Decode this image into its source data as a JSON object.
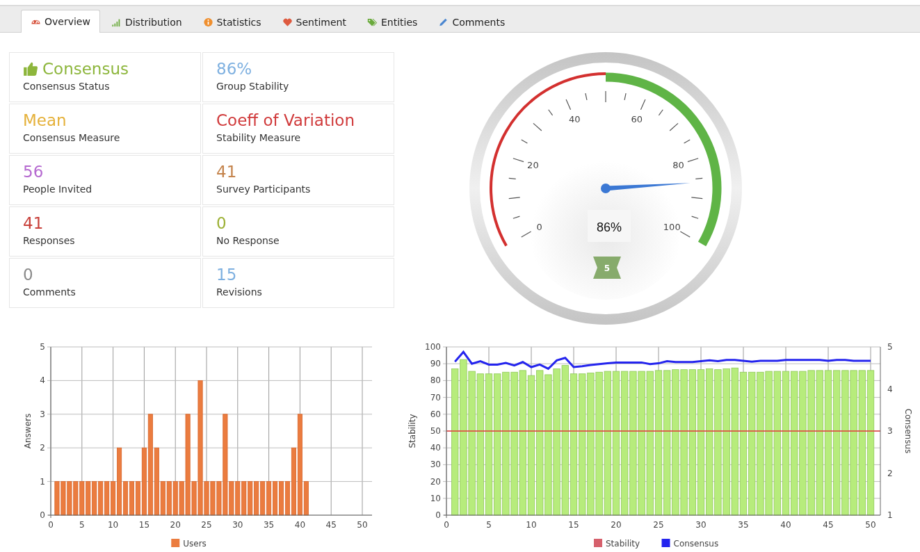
{
  "tabs": [
    {
      "label": "Overview",
      "selected": true
    },
    {
      "label": "Distribution",
      "selected": false
    },
    {
      "label": "Statistics",
      "selected": false
    },
    {
      "label": "Sentiment",
      "selected": false
    },
    {
      "label": "Entities",
      "selected": false
    },
    {
      "label": "Comments",
      "selected": false
    }
  ],
  "stats": [
    {
      "value": "Consensus",
      "label": "Consensus Status",
      "color": "#8db63c",
      "kind": "icon"
    },
    {
      "value": "86%",
      "label": "Group Stability",
      "color": "#7eb0e0",
      "kind": "plain"
    },
    {
      "value": "Mean",
      "label": "Consensus Measure",
      "color": "#e5b13a",
      "kind": "plain"
    },
    {
      "value": "Coeff of Variation",
      "label": "Stability Measure",
      "color": "#d03a3b",
      "kind": "plain"
    },
    {
      "value": "56",
      "label": "People Invited",
      "color": "#b569d0",
      "kind": "plain"
    },
    {
      "value": "41",
      "label": "Survey Participants",
      "color": "#c4834b",
      "kind": "plain"
    },
    {
      "value": "41",
      "label": "Responses",
      "color": "#c8403a",
      "kind": "plain"
    },
    {
      "value": "0",
      "label": "No Response",
      "color": "#9cb034",
      "kind": "plain"
    },
    {
      "value": "0",
      "label": "Comments",
      "color": "#8a8a8a",
      "kind": "plain"
    },
    {
      "value": "15",
      "label": "Revisions",
      "color": "#7eb0e0",
      "kind": "plain"
    }
  ],
  "gauge": {
    "reading": "86%",
    "badge": "5",
    "scale_labels": [
      "0",
      "20",
      "40",
      "60",
      "80",
      "100"
    ],
    "bands": [
      {
        "color": "#d3302f"
      },
      {
        "color": "#5fb446"
      }
    ]
  },
  "distribution_chart": {
    "chart_data": {
      "type": "bar",
      "ylabel": "Answers",
      "x": [
        1,
        2,
        3,
        4,
        5,
        6,
        7,
        8,
        9,
        10,
        11,
        12,
        13,
        14,
        15,
        16,
        17,
        18,
        19,
        20,
        21,
        22,
        23,
        24,
        25,
        26,
        27,
        28,
        29,
        30,
        31,
        32,
        33,
        34,
        35,
        36,
        37,
        38,
        39,
        40,
        41
      ],
      "series": [
        {
          "name": "Users",
          "color": "#eb7c3f",
          "values": [
            1,
            1,
            1,
            1,
            1,
            1,
            1,
            1,
            1,
            1,
            2,
            1,
            1,
            1,
            2,
            3,
            2,
            1,
            1,
            1,
            1,
            3,
            1,
            4,
            1,
            1,
            1,
            3,
            1,
            1,
            1,
            1,
            1,
            1,
            1,
            1,
            1,
            1,
            2,
            3,
            1
          ]
        }
      ],
      "xlim": [
        0,
        50
      ],
      "ylim": [
        0,
        5
      ],
      "xticks": [
        0,
        5,
        10,
        15,
        20,
        25,
        30,
        35,
        40,
        45,
        50
      ],
      "yticks": [
        0,
        1,
        2,
        3,
        4,
        5
      ],
      "grid": true
    }
  },
  "stability_chart": {
    "chart_data": {
      "type": "bar",
      "ylabel": "Stability",
      "y2label": "Consensus",
      "x": [
        1,
        2,
        3,
        4,
        5,
        6,
        7,
        8,
        9,
        10,
        11,
        12,
        13,
        14,
        15,
        16,
        17,
        18,
        19,
        20,
        21,
        22,
        23,
        24,
        25,
        26,
        27,
        28,
        29,
        30,
        31,
        32,
        33,
        34,
        35,
        36,
        37,
        38,
        39,
        40,
        41,
        42,
        43,
        44,
        45,
        46,
        47,
        48,
        49,
        50
      ],
      "series": [
        {
          "name": "Stability",
          "color": "#b7ec7c",
          "values": [
            87,
            92.5,
            85.5,
            84,
            84,
            84,
            85,
            85,
            86,
            83,
            86,
            83.5,
            87,
            89,
            84,
            84,
            84.5,
            85,
            85.5,
            85.5,
            85.5,
            85.5,
            85.5,
            85.5,
            86,
            86,
            86.5,
            86.5,
            86.5,
            86.5,
            87,
            86.5,
            87,
            87.5,
            85,
            85,
            85,
            85.5,
            85.5,
            85.5,
            85.5,
            85.5,
            86,
            86,
            86,
            86,
            86,
            86,
            86,
            86
          ]
        },
        {
          "name": "Consensus",
          "type": "line",
          "axis": "y2",
          "color": "#2424ee",
          "values": [
            4.65,
            4.88,
            4.6,
            4.66,
            4.58,
            4.58,
            4.62,
            4.56,
            4.64,
            4.52,
            4.58,
            4.48,
            4.68,
            4.74,
            4.52,
            4.54,
            4.57,
            4.59,
            4.61,
            4.63,
            4.63,
            4.63,
            4.63,
            4.59,
            4.61,
            4.66,
            4.64,
            4.64,
            4.64,
            4.66,
            4.68,
            4.66,
            4.69,
            4.69,
            4.67,
            4.65,
            4.67,
            4.67,
            4.67,
            4.69,
            4.69,
            4.69,
            4.69,
            4.69,
            4.67,
            4.69,
            4.69,
            4.67,
            4.67,
            4.67
          ]
        }
      ],
      "xlim": [
        0,
        50
      ],
      "ylim": [
        0,
        100
      ],
      "y2lim": [
        1,
        5
      ],
      "xticks": [
        0,
        5,
        10,
        15,
        20,
        25,
        30,
        35,
        40,
        45,
        50
      ],
      "yticks": [
        0,
        10,
        20,
        30,
        40,
        50,
        60,
        70,
        80,
        90,
        100
      ],
      "y2ticks": [
        1,
        2,
        3,
        4,
        5
      ],
      "ref_lines": [
        {
          "axis": "y",
          "value": 50,
          "color": "#e23b3b"
        }
      ],
      "grid": true
    },
    "legend_swatches": [
      {
        "color": "#d6606c"
      },
      {
        "color": "#2424ee"
      }
    ]
  }
}
